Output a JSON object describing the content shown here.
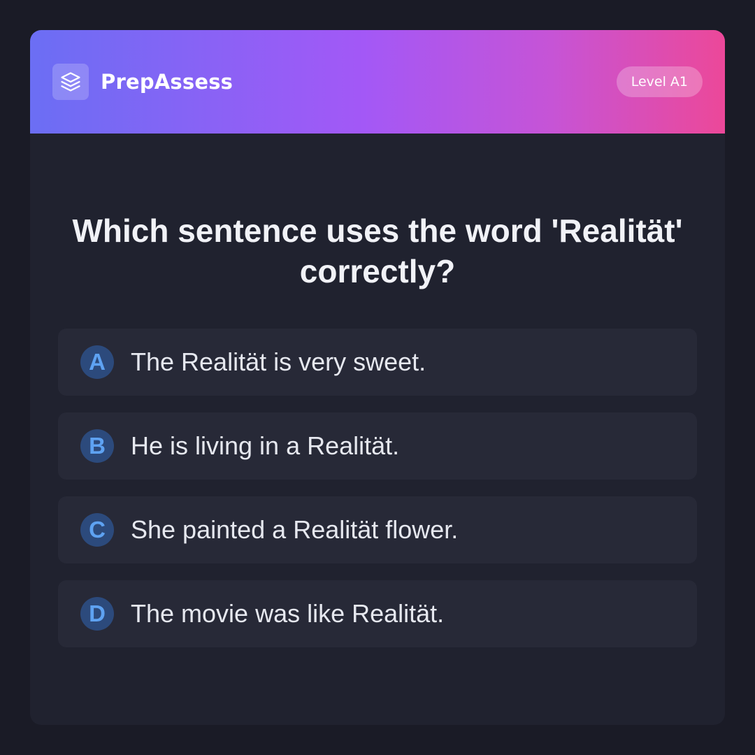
{
  "header": {
    "brand": "PrepAssess",
    "logo_icon": "layers-icon",
    "level_badge": "Level A1"
  },
  "question": {
    "text": "Which sentence uses the word 'Realität' correctly?"
  },
  "options": [
    {
      "letter": "A",
      "text": "The Realität is very sweet."
    },
    {
      "letter": "B",
      "text": "He is living in a Realität."
    },
    {
      "letter": "C",
      "text": "She painted a Realität flower."
    },
    {
      "letter": "D",
      "text": "The movie was like Realität."
    }
  ],
  "colors": {
    "background": "#1a1b26",
    "card": "#20222f",
    "option_bg": "#272937",
    "accent_blue": "#5ea2f2",
    "gradient_start": "#6b6ef4",
    "gradient_mid": "#a358f6",
    "gradient_end": "#ec4899"
  }
}
